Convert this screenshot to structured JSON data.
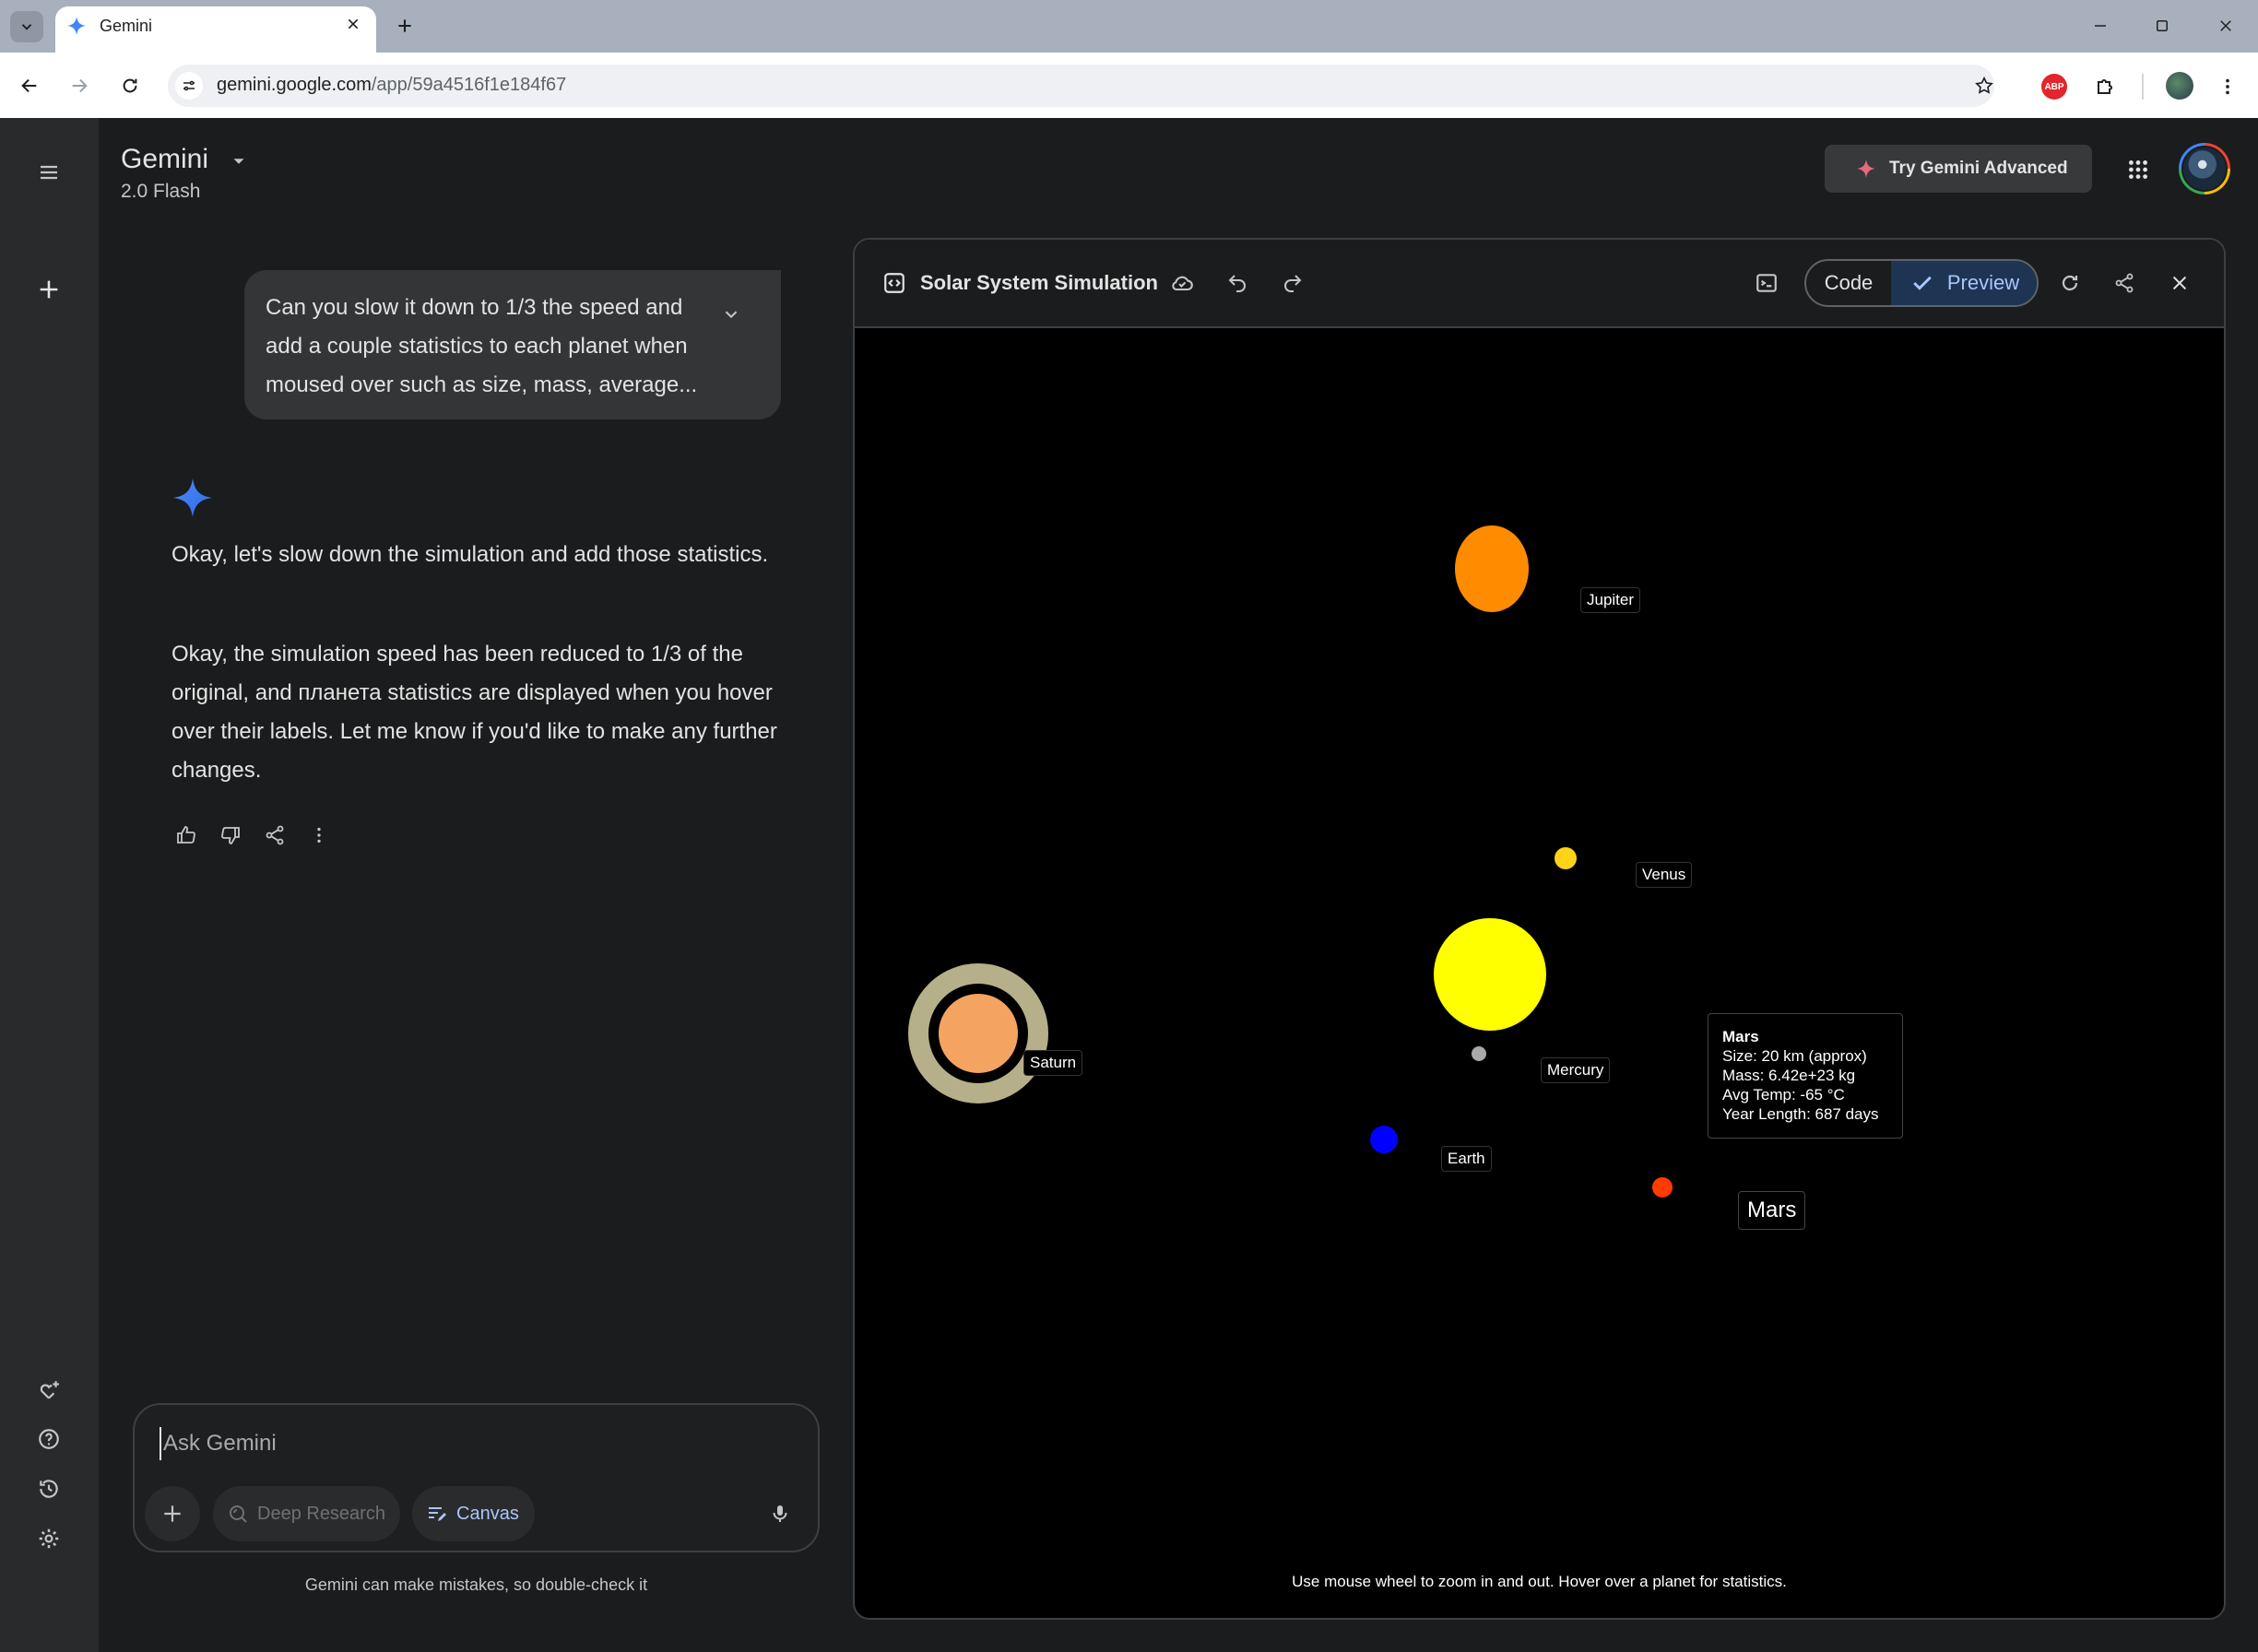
{
  "browser": {
    "tab_title": "Gemini",
    "url_host": "gemini.google.com",
    "url_path": "/app/59a4516f1e184f67",
    "extension_abp": "ABP"
  },
  "header": {
    "app_title": "Gemini",
    "model": "2.0 Flash",
    "try_advanced": "Try Gemini Advanced"
  },
  "chat": {
    "user_message": "Can you slow it down to 1/3 the speed and add a couple statistics to each planet when moused over such as size, mass, average...",
    "response_p1": "Okay, let's slow down the simulation and add those statistics.",
    "response_p2": "Okay, the simulation speed has been reduced to 1/3 of the original, and планета statistics are displayed when you hover over their labels. Let me know if you'd like to make any further changes."
  },
  "composer": {
    "placeholder": "Ask Gemini",
    "chip_deep_research": "Deep Research",
    "chip_canvas": "Canvas",
    "disclaimer": "Gemini can make mistakes, so double-check it"
  },
  "canvas": {
    "title": "Solar System Simulation",
    "code_label": "Code",
    "preview_label": "Preview"
  },
  "simulation": {
    "planets": {
      "jupiter": {
        "label": "Jupiter",
        "color": "#ff8c00"
      },
      "venus": {
        "label": "Venus",
        "color": "#ffd21a"
      },
      "sun": {
        "color": "#ffff00"
      },
      "mercury": {
        "label": "Mercury",
        "color": "#a9a9a9"
      },
      "saturn": {
        "label": "Saturn",
        "color": "#f4a460",
        "ring_color": "#b5b08a"
      },
      "earth": {
        "label": "Earth",
        "color": "#0000ff"
      },
      "mars": {
        "label": "Mars",
        "color": "#ff3c00"
      }
    },
    "tooltip": {
      "title": "Mars",
      "size": "Size: 20 km (approx)",
      "mass": "Mass: 6.42e+23 kg",
      "temp": "Avg Temp: -65 °C",
      "year": "Year Length: 687 days"
    },
    "hint": "Use mouse wheel to zoom in and out. Hover over a planet for statistics."
  },
  "colors": {
    "background": "#1b1c1d",
    "rail": "#282a2c",
    "accent_blue": "#a8c7fa",
    "preview_bg": "#1d3553"
  }
}
